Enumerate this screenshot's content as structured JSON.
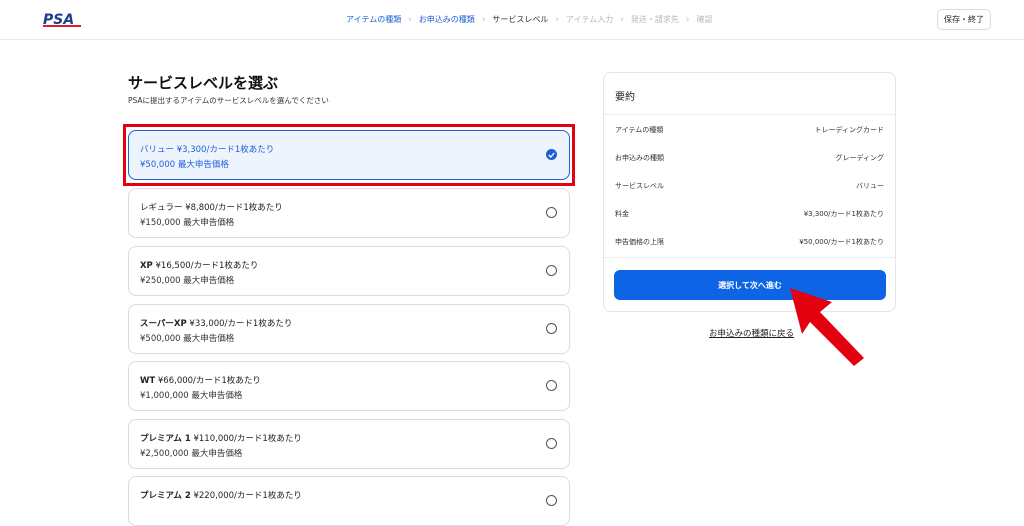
{
  "header": {
    "logo_text": "PSA",
    "steps": [
      {
        "label": "アイテムの種類",
        "state": "done"
      },
      {
        "label": "お申込みの種類",
        "state": "done"
      },
      {
        "label": "サービスレベル",
        "state": "current"
      },
      {
        "label": "アイテム入力",
        "state": "todo"
      },
      {
        "label": "発送・請求先",
        "state": "todo"
      },
      {
        "label": "確認",
        "state": "todo"
      }
    ],
    "save_label": "保存・終了"
  },
  "main": {
    "title": "サービスレベルを選ぶ",
    "subtitle": "PSAに提出するアイテムのサービスレベルを選んでください",
    "options": [
      {
        "name": "バリュー",
        "price": "¥3,300/カード1枚あたり",
        "max_value": "¥50,000 最大申告価格",
        "selected": true
      },
      {
        "name": "レギュラー",
        "price": "¥8,800/カード1枚あたり",
        "max_value": "¥150,000 最大申告価格",
        "selected": false
      },
      {
        "name": "XP",
        "price": "¥16,500/カード1枚あたり",
        "max_value": "¥250,000 最大申告価格",
        "selected": false
      },
      {
        "name": "スーパーXP",
        "price": "¥33,000/カード1枚あたり",
        "max_value": "¥500,000 最大申告価格",
        "selected": false
      },
      {
        "name": "WT",
        "price": "¥66,000/カード1枚あたり",
        "max_value": "¥1,000,000 最大申告価格",
        "selected": false
      },
      {
        "name": "プレミアム 1",
        "price": "¥110,000/カード1枚あたり",
        "max_value": "¥2,500,000 最大申告価格",
        "selected": false
      },
      {
        "name": "プレミアム 2",
        "price": "¥220,000/カード1枚あたり",
        "max_value": "",
        "selected": false
      }
    ]
  },
  "summary": {
    "title": "要約",
    "rows": [
      {
        "label": "アイテムの種類",
        "value": "トレーディングカード"
      },
      {
        "label": "お申込みの種類",
        "value": "グレーディング"
      },
      {
        "label": "サービスレベル",
        "value": "バリュー"
      },
      {
        "label": "料金",
        "value": "¥3,300/カード1枚あたり"
      },
      {
        "label": "申告価格の上限",
        "value": "¥50,000/カード1枚あたり"
      }
    ],
    "primary_label": "選択して次へ進む",
    "back_link": "お申込みの種類に戻る"
  },
  "colors": {
    "accent": "#0d65e6",
    "highlight": "#e3000f",
    "logo_red": "#d8202a",
    "logo_blue": "#1b3f8f"
  }
}
